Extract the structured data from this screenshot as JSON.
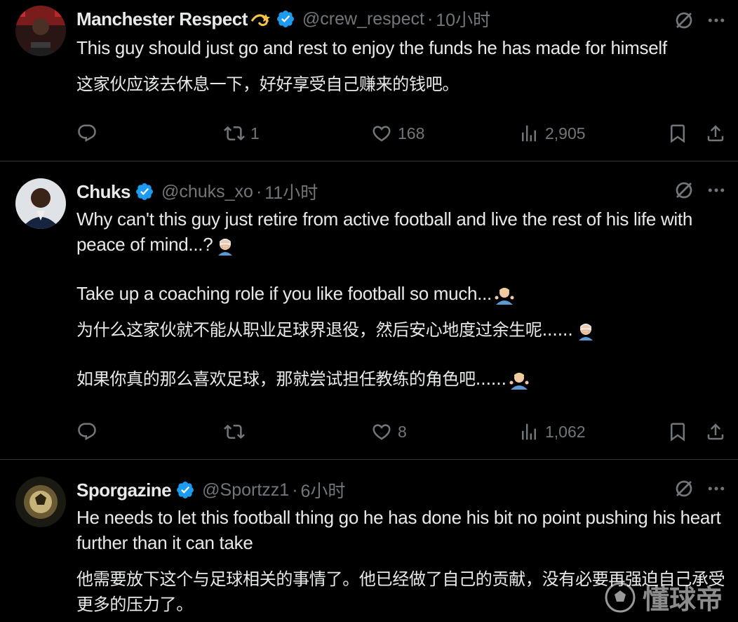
{
  "tweets": [
    {
      "name": "Manchester Respect",
      "name_emoji": "dizzy-emoji",
      "handle": "@crew_respect",
      "time": "10小时",
      "body": [
        {
          "text": "This guy should just go and rest to enjoy the funds he has made for himself",
          "lang": "en"
        },
        {
          "text": "这家伙应该去休息一下，好好享受自己赚来的钱吧。",
          "lang": "zh"
        }
      ],
      "stats": {
        "replies": "",
        "retweets": "1",
        "likes": "168",
        "views": "2,905"
      }
    },
    {
      "name": "Chuks",
      "handle": "@chuks_xo",
      "time": "11小时",
      "body": [
        {
          "text": "Why can't this guy just retire from active football and live the rest of his life with peace of mind...?",
          "lang": "en",
          "emoji": "person-facepalming"
        },
        {
          "text": "Take up a coaching role if you like football so much...",
          "lang": "en",
          "emoji": "person-shrugging"
        },
        {
          "text": "为什么这家伙就不能从职业足球界退役，然后安心地度过余生呢......",
          "lang": "zh",
          "emoji": "person-facepalming"
        },
        {
          "text": "如果你真的那么喜欢足球，那就尝试担任教练的角色吧......",
          "lang": "zh",
          "emoji": "person-shrugging"
        }
      ],
      "stats": {
        "replies": "",
        "retweets": "",
        "likes": "8",
        "views": "1,062"
      }
    },
    {
      "name": "Sporgazine",
      "handle": "@Sportzz1",
      "time": "6小时",
      "body": [
        {
          "text": "He needs to let this football thing go he has done his bit no point pushing his heart further than it can take",
          "lang": "en"
        },
        {
          "text": "他需要放下这个与足球相关的事情了。他已经做了自己的贡献，没有必要再强迫自己承受更多的压力了。",
          "lang": "zh"
        }
      ]
    }
  ],
  "watermark": {
    "text": "懂球帝"
  },
  "colors": {
    "background": "#000000",
    "text": "#e7e9ea",
    "muted": "#71767b",
    "verified": "#1d9bf0",
    "divider": "#2f3336"
  }
}
